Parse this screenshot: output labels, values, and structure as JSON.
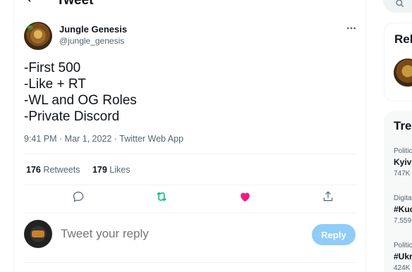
{
  "header": {
    "back_icon": "arrow-left-icon",
    "title": "Tweet"
  },
  "tweet": {
    "author_name": "Jungle Genesis",
    "author_handle": "@jungle_genesis",
    "lines": [
      "-First 500",
      "-Like + RT",
      "-WL and OG Roles",
      "-Private Discord"
    ],
    "meta": "9:41 PM · Mar 1, 2022 · Twitter Web App",
    "stats": {
      "retweets_count": "176",
      "retweets_label": "Retweets",
      "likes_count": "179",
      "likes_label": "Likes"
    },
    "colors": {
      "retweet_green": "#00ba7c",
      "like_pink": "#f91880",
      "icon_gray": "#536471"
    }
  },
  "reply": {
    "placeholder": "Tweet your reply",
    "button_label": "Reply",
    "button_color": "#8ecdf8"
  },
  "sidebar": {
    "relevant_title": "Rel",
    "trends_title": "Tre",
    "trends": [
      {
        "category": "Politic",
        "name": "Kyiv",
        "count": "747K"
      },
      {
        "category": "Digita",
        "name": "#Kuc",
        "count": "7,559"
      },
      {
        "category": "Politic",
        "name": "#Ukr",
        "count": "424K"
      }
    ]
  }
}
